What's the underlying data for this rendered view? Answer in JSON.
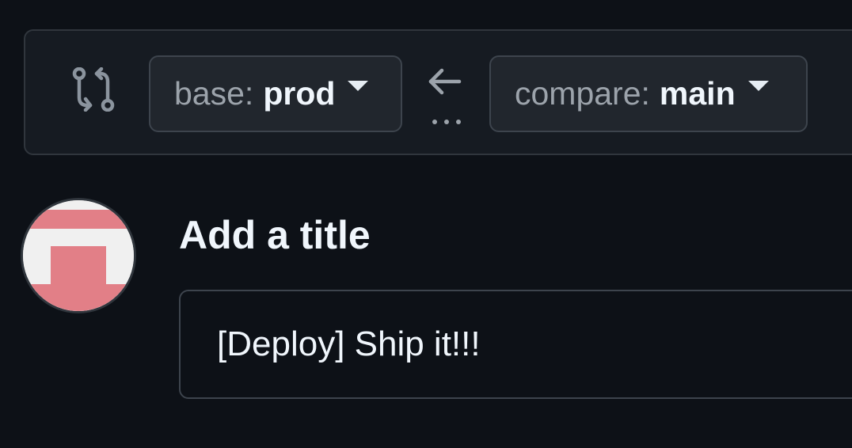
{
  "compare": {
    "icon": "git-compare-icon",
    "base": {
      "prefix": "base:",
      "branch": "prod"
    },
    "arrow_icon": "arrow-left-icon",
    "dots_icon": "kebab-horizontal-icon",
    "head": {
      "prefix": "compare:",
      "branch": "main"
    }
  },
  "pull_request": {
    "avatar_icon": "identicon-avatar",
    "title_label": "Add a title",
    "title_value": "[Deploy] Ship it!!!"
  },
  "colors": {
    "background": "#0d1117",
    "panel": "#161b22",
    "button": "#21262d",
    "border": "#30363d",
    "identicon": "#e27f87"
  }
}
